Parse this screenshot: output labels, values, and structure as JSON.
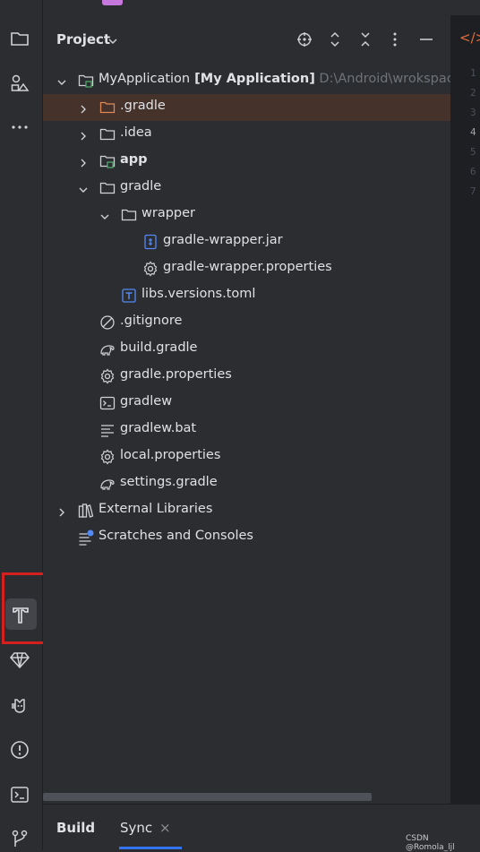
{
  "panel": {
    "title": "Project",
    "header_buttons": [
      "locate-icon",
      "expand-all-icon",
      "collapse-all-icon",
      "more-icon",
      "hide-icon"
    ]
  },
  "tree": [
    {
      "id": "root",
      "label": "MyApplication",
      "bold_suffix": "[My Application]",
      "path": "D:\\Android\\wrokspace\\M",
      "depth": 0,
      "expanded": true,
      "icon": "module-folder-icon"
    },
    {
      "id": "dot-gradle",
      "label": ".gradle",
      "depth": 1,
      "expanded": false,
      "icon": "folder-orange-icon"
    },
    {
      "id": "idea",
      "label": ".idea",
      "depth": 1,
      "expanded": false,
      "icon": "folder-icon"
    },
    {
      "id": "app",
      "label": "app",
      "depth": 1,
      "expanded": false,
      "icon": "module-folder-icon",
      "bold": true
    },
    {
      "id": "gradle",
      "label": "gradle",
      "depth": 1,
      "expanded": true,
      "icon": "folder-icon"
    },
    {
      "id": "wrapper",
      "label": "wrapper",
      "depth": 2,
      "expanded": true,
      "icon": "folder-icon"
    },
    {
      "id": "gw-jar",
      "label": "gradle-wrapper.jar",
      "depth": 3,
      "icon": "jar-icon"
    },
    {
      "id": "gw-props",
      "label": "gradle-wrapper.properties",
      "depth": 3,
      "icon": "settings-gear-icon"
    },
    {
      "id": "libs",
      "label": "libs.versions.toml",
      "depth": 2,
      "icon": "toml-icon"
    },
    {
      "id": "gitignore",
      "label": ".gitignore",
      "depth": 1,
      "icon": "ignore-icon"
    },
    {
      "id": "build-gradle",
      "label": "build.gradle",
      "depth": 1,
      "icon": "gradle-elephant-icon"
    },
    {
      "id": "gradle-props",
      "label": "gradle.properties",
      "depth": 1,
      "icon": "settings-gear-icon"
    },
    {
      "id": "gradlew",
      "label": "gradlew",
      "depth": 1,
      "icon": "terminal-icon"
    },
    {
      "id": "gradlew-bat",
      "label": "gradlew.bat",
      "depth": 1,
      "icon": "text-lines-icon"
    },
    {
      "id": "local-props",
      "label": "local.properties",
      "depth": 1,
      "icon": "settings-gear-icon"
    },
    {
      "id": "settings-gradle",
      "label": "settings.gradle",
      "depth": 1,
      "icon": "gradle-elephant-icon"
    },
    {
      "id": "ext-libs",
      "label": "External Libraries",
      "depth": 0,
      "expanded": false,
      "icon": "library-icon"
    },
    {
      "id": "scratches",
      "label": "Scratches and Consoles",
      "depth": 0,
      "icon": "scratches-icon"
    }
  ],
  "gutter_lines": [
    "1",
    "2",
    "3",
    "4",
    "5",
    "6",
    "7"
  ],
  "bottom_tabs": {
    "build": "Build",
    "sync": "Sync",
    "close": "×"
  },
  "watermark": "CSDN @Romola_ljl",
  "colors": {
    "accent": "#3574f0",
    "highlight_row": "#45322b",
    "annotation_red": "#d61f1f"
  }
}
